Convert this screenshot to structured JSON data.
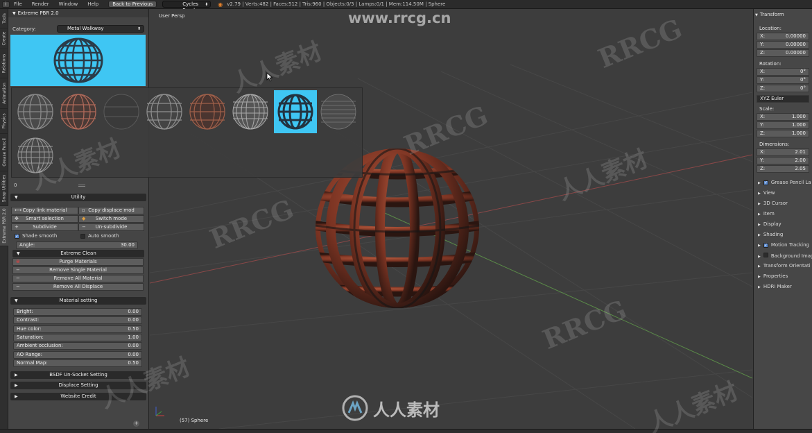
{
  "topbar": {
    "menus": [
      "File",
      "Render",
      "Window",
      "Help"
    ],
    "back_button": "Back to Previous",
    "engine": "Cycles Render",
    "stats": "v2.79 | Verts:482 | Faces:512 | Tris:960 | Objects:0/3 | Lamps:0/1 | Mem:114.50M | Sphere"
  },
  "vtabs": [
    "Tools",
    "Create",
    "Relations",
    "Animation",
    "Physics",
    "Grease Pencil",
    "Snap Utilities",
    "Extreme PBR 2.0"
  ],
  "leftpanel": {
    "title": "Extreme PBR 2.0",
    "category_label": "Category:",
    "category_value": "Metal Walkway",
    "zero_label": "0",
    "utility": {
      "header": "Utility",
      "copy_link": "Copy link material",
      "copy_displace": "Copy displace mod",
      "smart_selection": "Smart selection",
      "switch_mode": "Switch mode",
      "subdivide": "Subdivide",
      "unsubdivide": "Un-subdivide",
      "shade_smooth": "Shade smooth",
      "auto_smooth": "Auto smooth",
      "angle_label": "Angle:",
      "angle_value": "30.00"
    },
    "extreme_clean": {
      "header": "Extreme Clean",
      "purge": "Purge Materials",
      "remove_single": "Remove Single Material",
      "remove_all_material": "Remove All Material",
      "remove_all_displace": "Remove All Displace"
    },
    "material_setting": {
      "header": "Material setting",
      "fields": [
        {
          "label": "Bright:",
          "value": "0.00"
        },
        {
          "label": "Contrast:",
          "value": "0.00"
        },
        {
          "label": "Hue color:",
          "value": "0.50"
        },
        {
          "label": "Saturation:",
          "value": "1.00"
        },
        {
          "label": "Ambient occlusion:",
          "value": "0.00"
        },
        {
          "label": "AO Range:",
          "value": "0.00"
        },
        {
          "label": "Normal Map:",
          "value": "0.50"
        }
      ]
    },
    "bsdf": "BSDF Un-Socket Setting",
    "displace": "Displace Setting",
    "credit": "Website Credit"
  },
  "viewport": {
    "view_label": "User Persp",
    "object_label": "(57) Sphere"
  },
  "rightpanel": {
    "transform": "Transform",
    "location": "Location:",
    "loc": [
      {
        "axis": "X:",
        "value": "0.00000"
      },
      {
        "axis": "Y:",
        "value": "0.00000"
      },
      {
        "axis": "Z:",
        "value": "0.00000"
      }
    ],
    "rotation": "Rotation:",
    "rot": [
      {
        "axis": "X:",
        "value": "0°"
      },
      {
        "axis": "Y:",
        "value": "0°"
      },
      {
        "axis": "Z:",
        "value": "0°"
      }
    ],
    "rot_mode": "XYZ Euler",
    "scale": "Scale:",
    "scl": [
      {
        "axis": "X:",
        "value": "1.000"
      },
      {
        "axis": "Y:",
        "value": "1.000"
      },
      {
        "axis": "Z:",
        "value": "1.000"
      }
    ],
    "dimensions": "Dimensions:",
    "dim": [
      {
        "axis": "X:",
        "value": "2.01"
      },
      {
        "axis": "Y:",
        "value": "2.00"
      },
      {
        "axis": "Z:",
        "value": "2.05"
      }
    ],
    "sections": [
      "Grease Pencil La",
      "View",
      "3D Cursor",
      "Item",
      "Display",
      "Shading",
      "Motion Tracking",
      "Background Imag",
      "Transform Orientati",
      "Properties",
      "HDRi Maker"
    ]
  },
  "watermark": {
    "url": "www.rrcg.cn",
    "brand": "RRCG",
    "cn": "人人素材"
  },
  "colors": {
    "accent_blue": "#3fc6f3",
    "panel": "#454545",
    "viewport": "#3d3d3d"
  }
}
